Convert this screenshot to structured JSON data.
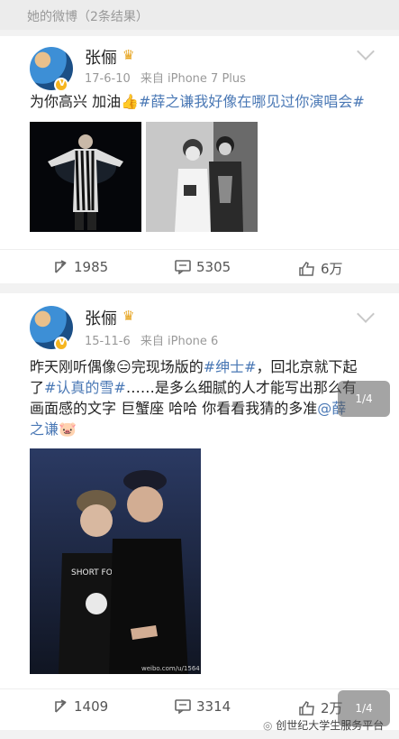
{
  "header": {
    "title": "她的微博（2条结果）"
  },
  "posts": [
    {
      "name": "张俪",
      "crown": "♛",
      "date": "17-6-10",
      "source": "来自 iPhone 7 Plus",
      "text_plain": "为你高兴 加油",
      "text_emoji": "👍",
      "tag": "#薛之谦我好像在哪见过你演唱会#",
      "shares": "1985",
      "comments": "5305",
      "likes": "6万"
    },
    {
      "name": "张俪",
      "crown": "♛",
      "date": "15-11-6",
      "source": "来自 iPhone 6",
      "line1_a": "昨天刚听偶像",
      "line1_emoji": "😑",
      "line1_b": "完现场版的",
      "tag1": "#绅士#",
      "line1_c": "，回北京就下起",
      "line2_a": "了",
      "tag2": "#认真的雪#",
      "line2_b": "……是多么细腻的人才能写出那么有",
      "line3_a": "画面感的文字 巨蟹座 哈哈 你看看我猜的多准",
      "mention": "@薛",
      "line4_mention": "之谦",
      "line4_emoji": "🐷",
      "photo_caption": "SHORT FOOT",
      "photo_watermark": "weibo.com/u/1564",
      "shares": "1409",
      "comments": "3314",
      "likes": "2万"
    }
  ],
  "pager_top": "1/4",
  "pager_bottom": "1/4",
  "watermark": "创世纪大学生服务平台"
}
